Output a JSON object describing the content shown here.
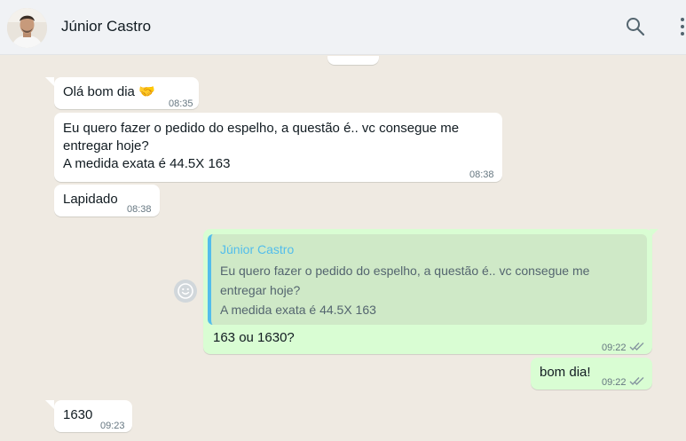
{
  "header": {
    "contact_name": "Júnior Castro",
    "icons": [
      "search-icon",
      "menu-icon"
    ]
  },
  "colors": {
    "chat_background": "#efeae2",
    "incoming_bubble": "#ffffff",
    "outgoing_bubble": "#d9fdd3",
    "quote_accent": "#53bdeb",
    "ticks": "#8696a0"
  },
  "messages": [
    {
      "direction": "in",
      "text": "Olá bom dia 🤝",
      "time": "08:35"
    },
    {
      "direction": "in",
      "text": "Eu quero fazer o pedido do espelho, a questão é.. vc consegue me\nentregar hoje?\nA medida exata é 44.5X 163",
      "time": "08:38"
    },
    {
      "direction": "in",
      "text": "Lapidado",
      "time": "08:38"
    },
    {
      "direction": "out",
      "quote": {
        "author": "Júnior Castro",
        "text": "Eu quero fazer o pedido do espelho, a questão é.. vc consegue me\nentregar hoje?\nA medida exata é 44.5X 163"
      },
      "text": "163 ou 1630?",
      "time": "09:22",
      "status": "read"
    },
    {
      "direction": "out",
      "text": "bom dia!",
      "time": "09:22",
      "status": "read"
    },
    {
      "direction": "in",
      "text": "1630",
      "time": "09:23"
    }
  ]
}
